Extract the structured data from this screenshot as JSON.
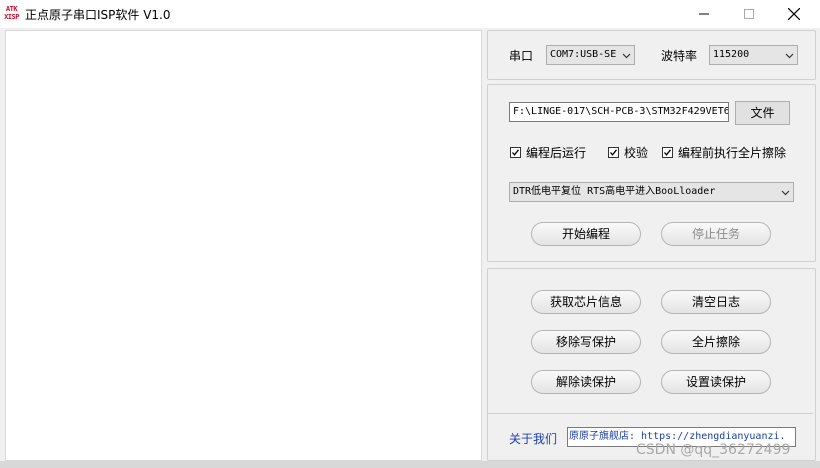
{
  "window": {
    "app_icon_text": "ATK XISP",
    "title": "正点原子串口ISP软件 V1.0"
  },
  "serial": {
    "port_label": "串口",
    "port_value": "COM7:USB-SE",
    "baud_label": "波特率",
    "baud_value": "115200"
  },
  "program": {
    "file_path": "F:\\LINGE-017\\SCH-PCB-3\\STM32F429VET6",
    "file_button": "文件",
    "checkbox_run_after": {
      "label": "编程后运行",
      "checked": true
    },
    "checkbox_verify": {
      "label": "校验",
      "checked": true
    },
    "checkbox_erase_before": {
      "label": "编程前执行全片擦除",
      "checked": true
    },
    "boot_mode": "DTR低电平复位 RTS高电平进入BooLloader",
    "start_button": "开始编程",
    "stop_button": "停止任务"
  },
  "actions": {
    "get_chip_info": "获取芯片信息",
    "clear_log": "清空日志",
    "remove_write_protect": "移除写保护",
    "full_erase": "全片擦除",
    "remove_read_protect": "解除读保护",
    "set_read_protect": "设置读保护"
  },
  "footer": {
    "about_link": "关于我们",
    "shop_text": "原原子旗舰店: https://zhengdianyuanzi."
  },
  "watermark": "CSDN @qq_36272499",
  "colors": {
    "link": "#1a3fae",
    "icon_red": "#c8102e"
  }
}
